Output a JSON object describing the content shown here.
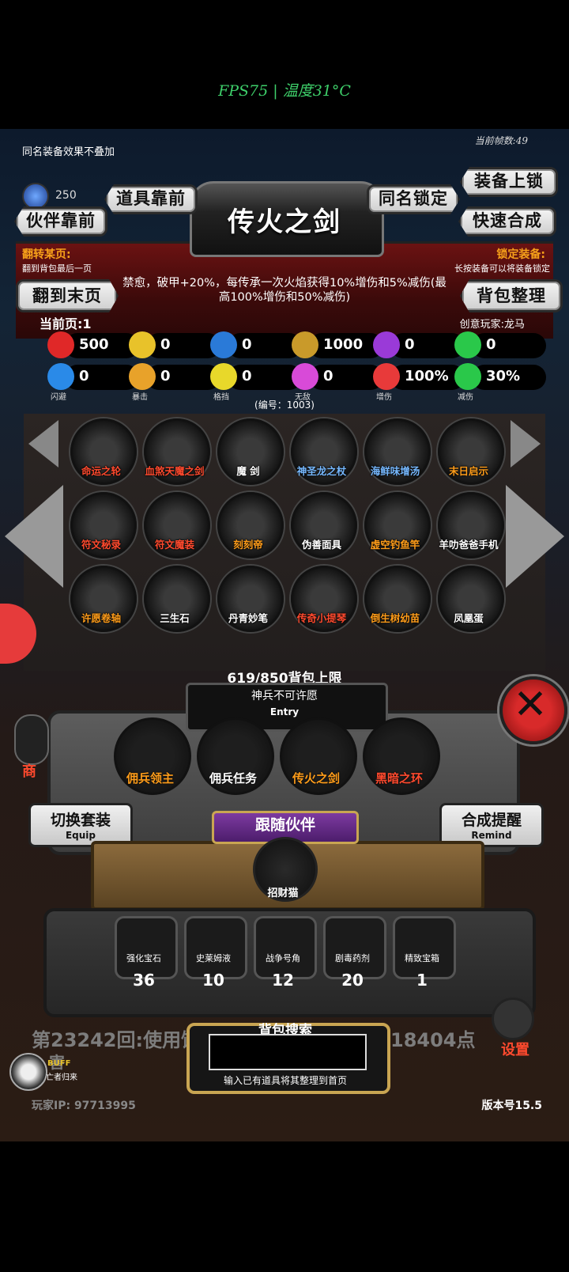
{
  "status_bar": {
    "fps_text": "FPS75 | 温度31°C"
  },
  "header": {
    "top_note": "同名装备效果不叠加",
    "frame_count": "当前帧数:49",
    "gem_count": "250",
    "title": "传火之剑",
    "buttons": {
      "items_first": "道具靠前",
      "companion_first": "伙伴靠前",
      "same_name_lock": "同名锁定",
      "equip_lock": "装备上锁",
      "quick_synth": "快速合成",
      "to_last_page": "翻到末页",
      "sort_bag": "背包整理"
    },
    "flip_page_label": "翻转某页:",
    "flip_page_sub": "翻到背包最后一页",
    "lock_equip_label": "锁定装备:",
    "lock_equip_sub": "长按装备可以将装备锁定",
    "description": "禁愈，破甲+20%，每传承一次火焰获得10%增伤和5%减伤(最高100%增伤和50%减伤)",
    "current_page": "当前页:1",
    "creator": "创意玩家:龙马"
  },
  "stats": {
    "row1": [
      {
        "icon": "heart-icon",
        "value": "500",
        "color": "#e02828"
      },
      {
        "icon": "armor-icon",
        "value": "0",
        "color": "#e8c22a"
      },
      {
        "icon": "boot-icon",
        "value": "0",
        "color": "#2a7ad8"
      },
      {
        "icon": "sword-icon",
        "value": "1000",
        "color": "#c99a2a"
      },
      {
        "icon": "lightning-icon",
        "value": "0",
        "color": "#9a3ad8"
      },
      {
        "icon": "clover-icon",
        "value": "0",
        "color": "#2ac84a"
      }
    ],
    "row2": [
      {
        "icon": "dodge-icon",
        "value": "0",
        "label": "闪避",
        "color": "#2a8ae8"
      },
      {
        "icon": "crit-icon",
        "value": "0",
        "label": "暴击",
        "color": "#e8a22a"
      },
      {
        "icon": "block-icon",
        "value": "0",
        "label": "格挡",
        "color": "#e8d82a"
      },
      {
        "icon": "invincible-icon",
        "value": "0",
        "label": "无敌",
        "color": "#d84ad8"
      },
      {
        "icon": "damage-up-icon",
        "value": "100%",
        "label": "增伤",
        "color": "#e83a3a"
      },
      {
        "icon": "damage-reduce-icon",
        "value": "30%",
        "label": "减伤",
        "color": "#2ac84a"
      }
    ],
    "id_line": "(编号：1003)"
  },
  "inventory": {
    "items": [
      {
        "name": "命运之轮",
        "color": "red",
        "icon": "wheel-icon"
      },
      {
        "name": "血煞天魔之剑",
        "color": "red",
        "icon": "demon-sword-icon"
      },
      {
        "name": "魔 剑",
        "color": "white",
        "icon": "magic-sword-icon"
      },
      {
        "name": "神圣龙之杖",
        "color": "blue",
        "icon": "dragon-staff-icon"
      },
      {
        "name": "海鲜味增汤",
        "color": "blue",
        "icon": "soup-icon"
      },
      {
        "name": "末日启示",
        "color": "orange",
        "icon": "axes-icon"
      },
      {
        "name": "符文秘录",
        "color": "red",
        "icon": "horn-icon"
      },
      {
        "name": "符文魔装",
        "color": "red",
        "icon": "rune-armor-icon"
      },
      {
        "name": "刻刻帝",
        "color": "orange",
        "icon": "clock-icon"
      },
      {
        "name": "伪善面具",
        "color": "white",
        "icon": "mask-icon"
      },
      {
        "name": "虚空钓鱼竿",
        "color": "orange",
        "icon": "fishing-rod-icon"
      },
      {
        "name": "羊叻爸爸手机",
        "color": "white",
        "icon": "phone-icon"
      },
      {
        "name": "许愿卷轴",
        "color": "orange",
        "icon": "scroll-icon"
      },
      {
        "name": "三生石",
        "color": "white",
        "icon": "stone-icon"
      },
      {
        "name": "丹青妙笔",
        "color": "white",
        "icon": "brush-icon"
      },
      {
        "name": "传奇小提琴",
        "color": "red",
        "icon": "violin-icon"
      },
      {
        "name": "倒生树幼苗",
        "color": "orange",
        "icon": "sapling-icon"
      },
      {
        "name": "凤凰蛋",
        "color": "white",
        "icon": "egg-icon"
      }
    ],
    "capacity": "619/850背包上限"
  },
  "entry": {
    "text": "神兵不可许愿",
    "label": "Entry"
  },
  "equipped": [
    {
      "name": "佣兵领主",
      "color": "orange",
      "icon": "knight-icon"
    },
    {
      "name": "佣兵任务",
      "color": "white",
      "icon": "horn-icon"
    },
    {
      "name": "传火之剑",
      "color": "orange",
      "icon": "flame-sword-icon"
    },
    {
      "name": "黑暗之环",
      "color": "red",
      "icon": "dark-ring-icon"
    }
  ],
  "switch_set": {
    "label": "切换套装",
    "sub": "Equip"
  },
  "synth_remind": {
    "label": "合成提醒",
    "sub": "Remind"
  },
  "follow": {
    "title": "跟随伙伴",
    "companion": "招财猫"
  },
  "materials": [
    {
      "name": "强化宝石",
      "count": "36",
      "icon": "gem-icon"
    },
    {
      "name": "史莱姆液",
      "count": "10",
      "icon": "potion-icon"
    },
    {
      "name": "战争号角",
      "count": "12",
      "icon": "war-horn-icon"
    },
    {
      "name": "剧毒药剂",
      "count": "20",
      "icon": "poison-icon"
    },
    {
      "name": "精致宝箱",
      "count": "1",
      "icon": "chest-icon"
    }
  ],
  "footer": {
    "log_left": "第23242回:使用饮",
    "log_right": "18404点",
    "log_2": "害",
    "search_title": "背包搜索",
    "search_value": "",
    "search_hint": "输入已有道具将其整理到首页",
    "player_ip": "玩家IP:   97713995",
    "version": "版本号15.5",
    "settings": "设置",
    "buff_label": "BUFF",
    "buff_sub": "亡者归来",
    "side_label": "商"
  }
}
